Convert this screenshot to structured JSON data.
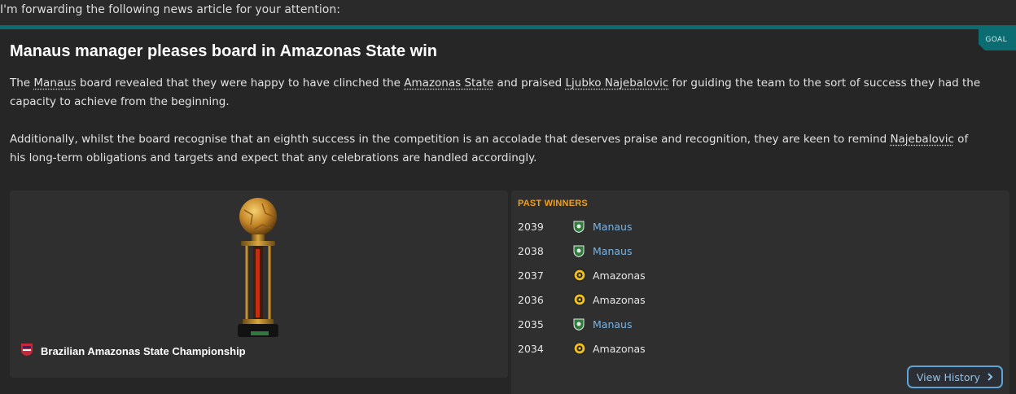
{
  "intro": "I'm forwarding the following news article for your attention:",
  "article": {
    "tag": "GOAL",
    "headline": "Manaus manager pleases board in Amazonas State win",
    "para1": {
      "s1": "The ",
      "club": "Manaus",
      "s2": " board revealed that they were happy to have clinched the ",
      "competition": "Amazonas State",
      "s3": " and praised ",
      "manager": "Ljubko Najebalovic",
      "s4": " for guiding the team to the sort of success they had the capacity to achieve from the beginning."
    },
    "para2": {
      "s1": "Additionally, whilst the board recognise that an eighth success in the competition is an accolade that deserves praise and recognition, they are keen to remind ",
      "manager": "Najebalovic",
      "s2": " of his long-term obligations and targets and expect that any celebrations are handled accordingly."
    }
  },
  "trophy_panel": {
    "competition_name": "Brazilian Amazonas State Championship",
    "competition_icon": "fa-badge-icon",
    "trophy_icon": "trophy-icon"
  },
  "past_winners": {
    "title": "PAST WINNERS",
    "rows": [
      {
        "year": "2039",
        "team": "Manaus",
        "crest": "manaus-crest-icon"
      },
      {
        "year": "2038",
        "team": "Manaus",
        "crest": "manaus-crest-icon"
      },
      {
        "year": "2037",
        "team": "Amazonas",
        "crest": "amazonas-crest-icon"
      },
      {
        "year": "2036",
        "team": "Amazonas",
        "crest": "amazonas-crest-icon"
      },
      {
        "year": "2035",
        "team": "Manaus",
        "crest": "manaus-crest-icon"
      },
      {
        "year": "2034",
        "team": "Amazonas",
        "crest": "amazonas-crest-icon"
      }
    ],
    "view_history_label": "View History"
  },
  "colors": {
    "accent_teal": "#0b6d72",
    "winners_title": "#f0a020",
    "link_blue": "#7bb3e0"
  }
}
